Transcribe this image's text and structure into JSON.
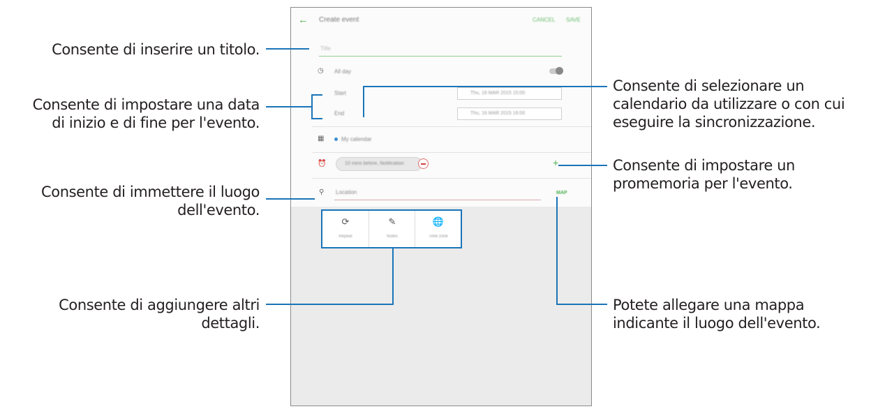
{
  "screen": {
    "title": "Create event",
    "cancel_label": "CANCEL",
    "save_label": "SAVE",
    "back_icon": "back-arrow-icon",
    "title_placeholder": "Title",
    "all_day_label": "All day",
    "start_label": "Start",
    "end_label": "End",
    "start_value": "Thu, 16 MAR 2015   15:00",
    "end_value": "Thu, 16 MAR 2015   16:00",
    "calendar_label": "My calendar",
    "reminder_chip": "10 mins before, Notification",
    "location_placeholder": "Location",
    "map_label": "MAP",
    "detail_buttons": [
      {
        "icon": "repeat-icon",
        "label": "Repeat"
      },
      {
        "icon": "notes-icon",
        "label": "Notes"
      },
      {
        "icon": "time-zone-icon",
        "label": "Time zone"
      }
    ],
    "accent_color": "#4caf50"
  },
  "annotations": {
    "title": "Consente di inserire un titolo.",
    "dates": [
      "Consente di impostare una data",
      "di inizio e di fine per l'evento."
    ],
    "location": [
      "Consente di immettere il luogo",
      "dell'evento."
    ],
    "details": [
      "Consente di aggiungere altri",
      "dettagli."
    ],
    "calendar": [
      "Consente di selezionare un",
      "calendario da utilizzare o con cui",
      "eseguire la sincronizzazione."
    ],
    "reminder": [
      "Consente di impostare un",
      "promemoria per l'evento."
    ],
    "map": [
      "Potete allegare una mappa",
      "indicante il luogo dell'evento."
    ],
    "leader_color": "#1a74b8"
  }
}
